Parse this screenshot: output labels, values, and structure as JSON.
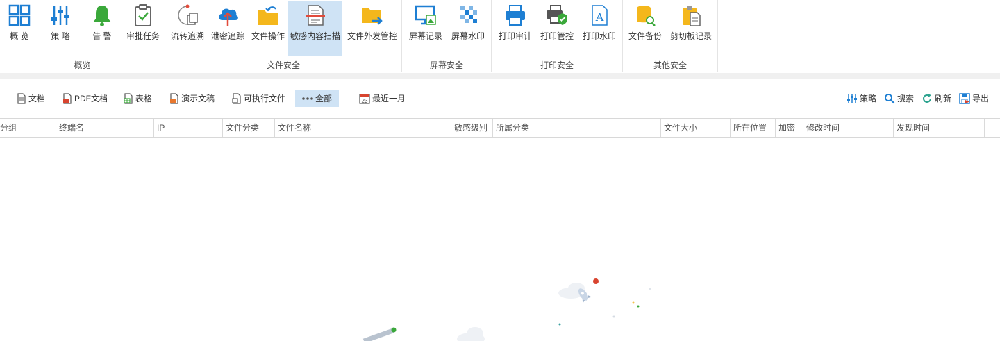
{
  "ribbon": {
    "groups": [
      {
        "label": "概览",
        "buttons": [
          {
            "label": "概 览",
            "icon": "overview-grid-icon"
          },
          {
            "label": "策 略",
            "icon": "policy-sliders-icon"
          },
          {
            "label": "告 警",
            "icon": "alert-bell-icon"
          },
          {
            "label": "审批任务",
            "icon": "approval-clipboard-icon"
          }
        ]
      },
      {
        "label": "文件安全",
        "buttons": [
          {
            "label": "流转追溯",
            "icon": "trace-flow-icon"
          },
          {
            "label": "泄密追踪",
            "icon": "cloud-upload-icon"
          },
          {
            "label": "文件操作",
            "icon": "folder-operation-icon"
          },
          {
            "label": "敏感内容扫描",
            "icon": "document-scan-icon",
            "active": true
          },
          {
            "label": "文件外发管控",
            "icon": "folder-send-icon"
          }
        ]
      },
      {
        "label": "屏幕安全",
        "buttons": [
          {
            "label": "屏幕记录",
            "icon": "screen-record-icon"
          },
          {
            "label": "屏幕水印",
            "icon": "screen-watermark-icon"
          }
        ]
      },
      {
        "label": "打印安全",
        "buttons": [
          {
            "label": "打印审计",
            "icon": "printer-icon"
          },
          {
            "label": "打印管控",
            "icon": "printer-shield-icon"
          },
          {
            "label": "打印水印",
            "icon": "print-watermark-icon"
          }
        ]
      },
      {
        "label": "其他安全",
        "buttons": [
          {
            "label": "文件备份",
            "icon": "database-backup-icon"
          },
          {
            "label": "剪切板记录",
            "icon": "clipboard-icon"
          }
        ]
      }
    ]
  },
  "toolbar": {
    "filters": [
      {
        "label": "文档",
        "icon": "document-icon"
      },
      {
        "label": "PDF文档",
        "icon": "pdf-icon"
      },
      {
        "label": "表格",
        "icon": "spreadsheet-icon"
      },
      {
        "label": "演示文稿",
        "icon": "presentation-icon"
      },
      {
        "label": "可执行文件",
        "icon": "executable-icon"
      },
      {
        "label": "全部",
        "icon": "more-dots-icon",
        "selected": true
      }
    ],
    "date_range": {
      "label": "最近一月",
      "icon": "calendar-icon",
      "icon_text": "23"
    },
    "actions": [
      {
        "label": "策略",
        "icon": "policy-sliders-icon"
      },
      {
        "label": "搜索",
        "icon": "search-icon"
      },
      {
        "label": "刷新",
        "icon": "refresh-icon"
      },
      {
        "label": "导出",
        "icon": "export-icon"
      }
    ]
  },
  "table": {
    "columns": [
      "分组",
      "终端名",
      "IP",
      "文件分类",
      "文件名称",
      "敏感级别",
      "所属分类",
      "文件大小",
      "所在位置",
      "加密",
      "修改时间",
      "发现时间"
    ],
    "rows": []
  },
  "colors": {
    "accent": "#1e7fd3",
    "selected_bg": "#cfe3f5",
    "folder_yellow": "#f4b71c",
    "alert_green": "#3aa83a"
  }
}
